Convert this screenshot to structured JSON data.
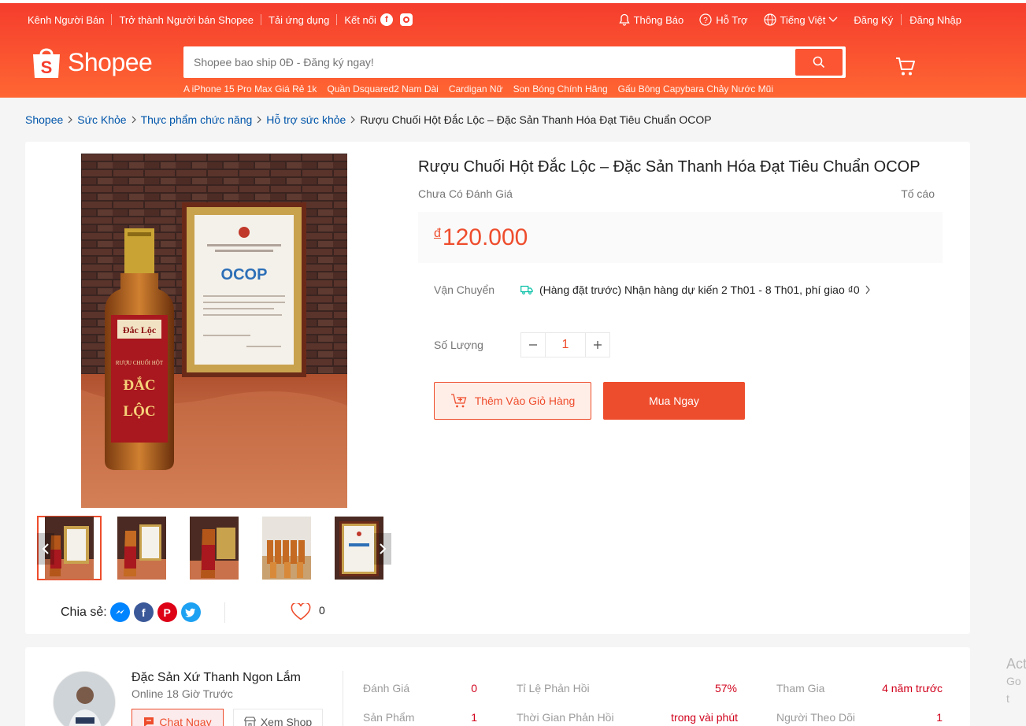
{
  "navbar": {
    "left": [
      "Kênh Người Bán",
      "Trở thành Người bán Shopee",
      "Tải ứng dụng",
      "Kết nối"
    ],
    "notifications": "Thông Báo",
    "help": "Hỗ Trợ",
    "language": "Tiếng Việt",
    "register": "Đăng Ký",
    "login": "Đăng Nhập"
  },
  "header": {
    "logo_text": "Shopee",
    "search_placeholder": "Shopee bao ship 0Đ - Đăng ký ngay!",
    "keywords": [
      "A iPhone 15 Pro Max Giá Rẻ 1k",
      "Quần Dsquared2 Nam Dài",
      "Cardigan Nữ",
      "Son Bóng Chính Hãng",
      "Gấu Bông Capybara Chảy Nước Mũi"
    ]
  },
  "breadcrumb": [
    "Shopee",
    "Sức Khỏe",
    "Thực phẩm chức năng",
    "Hỗ trợ sức khỏe"
  ],
  "breadcrumb_current": "Rượu Chuối Hột Đắc Lộc – Đặc Sản Thanh Hóa Đạt Tiêu Chuẩn OCOP",
  "product": {
    "title": "Rượu Chuối Hột Đắc Lộc – Đặc Sản Thanh Hóa Đạt Tiêu Chuẩn OCOP",
    "rating_text": "Chưa Có Đánh Giá",
    "report": "Tố cáo",
    "currency": "đ",
    "price": "120.000",
    "shipping_label": "Vận Chuyển",
    "shipping_text": "(Hàng đặt trước) Nhận hàng dự kiến 2 Th01 - 8 Th01, phí giao ₫0",
    "quantity_label": "Số Lượng",
    "quantity": "1",
    "add_to_cart": "Thêm Vào Giỏ Hàng",
    "buy_now": "Mua Ngay",
    "share_label": "Chia sẻ:",
    "likes": "0",
    "bottle_label_brand": "Đắc Lộc",
    "bottle_label_name": "RƯỢU CHUỐI HỘT",
    "bottle_label_big1": "ĐẮC",
    "bottle_label_big2": "LỘC",
    "certificate_text": "OCOP"
  },
  "shop": {
    "name": "Đặc Sản Xứ Thanh Ngon Lắm",
    "online": "Online 18 Giờ Trước",
    "chat": "Chat Ngay",
    "view": "Xem Shop",
    "stats": [
      {
        "label": "Đánh Giá",
        "value": "0"
      },
      {
        "label": "Tỉ Lệ Phản Hồi",
        "value": "57%"
      },
      {
        "label": "Tham Gia",
        "value": "4 năm trước"
      },
      {
        "label": "Sản Phẩm",
        "value": "1"
      },
      {
        "label": "Thời Gian Phản Hồi",
        "value": "trong vài phút"
      },
      {
        "label": "Người Theo Dõi",
        "value": "1"
      }
    ]
  },
  "watermark": {
    "line1": "Act",
    "line2": "Go t"
  },
  "colors": {
    "brand": "#ee4d2d",
    "header_top": "#f53d2d",
    "header_bottom": "#ff6633",
    "link": "#0055aa"
  }
}
